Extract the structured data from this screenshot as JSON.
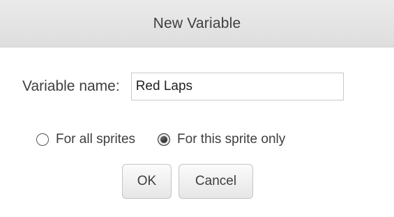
{
  "dialog": {
    "title": "New Variable",
    "name_label": "Variable name:",
    "name_value": "Red Laps",
    "scope_options": [
      {
        "label": "For all sprites",
        "checked": false
      },
      {
        "label": "For this sprite only",
        "checked": true
      }
    ],
    "ok_label": "OK",
    "cancel_label": "Cancel"
  },
  "colors": {
    "title_bar": "#e4e4e4",
    "text": "#3e3e3e",
    "input_border": "#c8c8c8"
  },
  "icons": {
    "radio_unchecked": "radio-unchecked-icon",
    "radio_checked": "radio-checked-icon"
  }
}
